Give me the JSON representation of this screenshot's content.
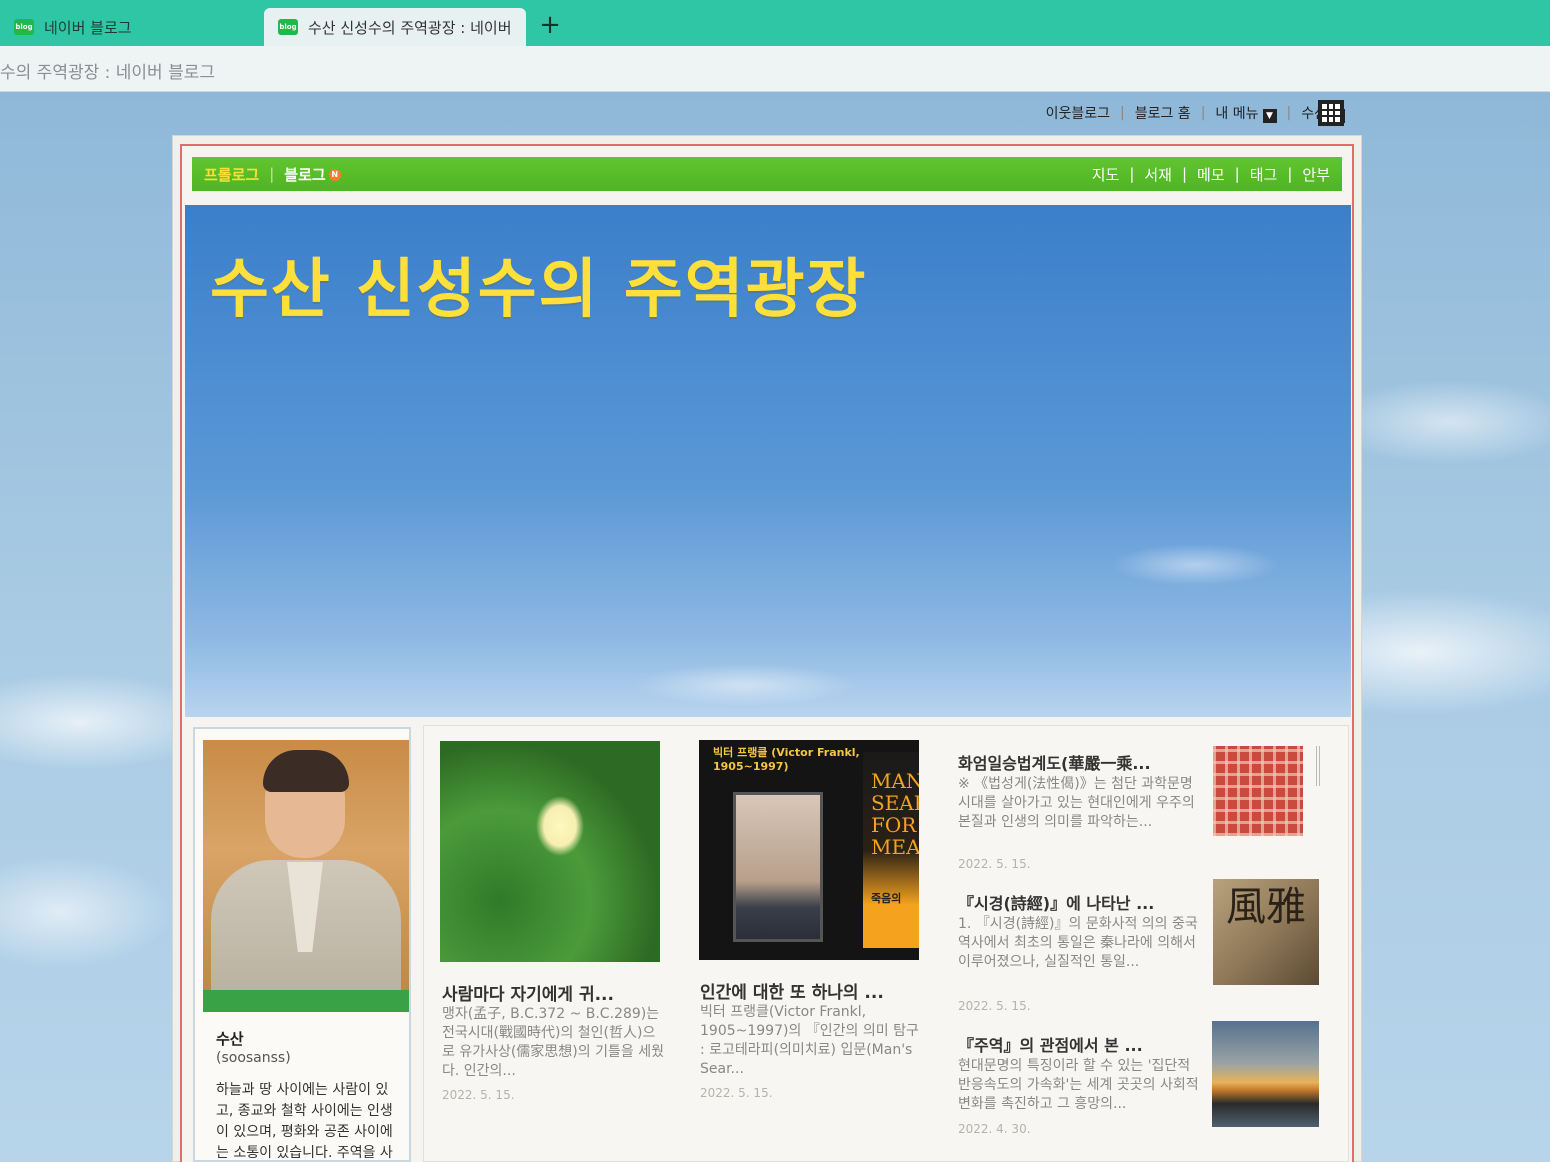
{
  "browser": {
    "tabs": [
      {
        "label": "네이버 블로그",
        "favicon": "blog",
        "active": false
      },
      {
        "label": "수산 신성수의 주역광장 : 네이버",
        "favicon": "blog",
        "active": true
      }
    ],
    "new_tab": "+",
    "address": "수의 주역광장 : 네이버 블로그"
  },
  "top_links": {
    "neighbor_blog": "이웃블로그",
    "blog_home": "블로그 홈",
    "my_menu": "내 메뉴",
    "user": "수산"
  },
  "green_menu": {
    "left": [
      "프롤로그",
      "블로그"
    ],
    "blog_badge": "N",
    "right": [
      "지도",
      "서재",
      "메모",
      "태그",
      "안부"
    ]
  },
  "blog_title": "수산 신성수의 주역광장",
  "profile": {
    "name": "수산",
    "id": "(soosanss)",
    "description": "하늘과 땅 사이에는 사람이 있고, 종교와 철학 사이에는 인생이 있으며, 평화와 공존 사이에는 소통이 있습니다. 주역을 사랑하는 도"
  },
  "featured_posts": [
    {
      "title": "사람마다 자기에게 귀...",
      "excerpt": "맹자(孟子, B.C.372 ~ B.C.289)는 전국시대(戰國時代)의 철인(哲人)으로 유가사상(儒家思想)의 기틀을 세웠다. 인간의...",
      "date": "2022. 5. 15."
    },
    {
      "title": "인간에 대한 또 하나의 ...",
      "excerpt": "빅터 프랭클(Victor Frankl, 1905~1997)의 『인간의 의미 탐구 : 로고테라피(의미치료) 입문(Man's Sear...",
      "date": "2022. 5. 15.",
      "thumb_caption": "빅터 프랭클 (Victor Frankl, 1905~1997)",
      "book_text": "MAN'S SEARCH FOR MEANING",
      "book_kor": "죽음의"
    }
  ],
  "side_posts": [
    {
      "title": "화엄일승법계도(華嚴一乘...",
      "excerpt": "※ 《법성게(法性偈)》는 첨단 과학문명 시대를 살아가고 있는 현대인에게 우주의 본질과 인생의 의미를 파악하는...",
      "date": "2022. 5. 15."
    },
    {
      "title": "『시경(詩經)』에 나타난 ...",
      "excerpt": "1. 『시경(詩經)』의 문화사적 의의 중국 역사에서 최초의 통일은 秦나라에 의해서 이루어졌으나, 실질적인 통일...",
      "date": "2022. 5. 15.",
      "thumb_text": "風雅"
    },
    {
      "title": "『주역』의 관점에서 본 ...",
      "excerpt": "현대문명의 특징이라 할 수 있는 '집단적 반응속도의 가속화'는 세계 곳곳의 사회적 변화를 촉진하고 그 흥망의...",
      "date": "2022. 4. 30."
    }
  ],
  "colors": {
    "tab_bar": "#2ec6a4",
    "menu_green": "#58bd2a",
    "title_yellow": "#ffe03a",
    "frame_red": "#e36b6b"
  }
}
